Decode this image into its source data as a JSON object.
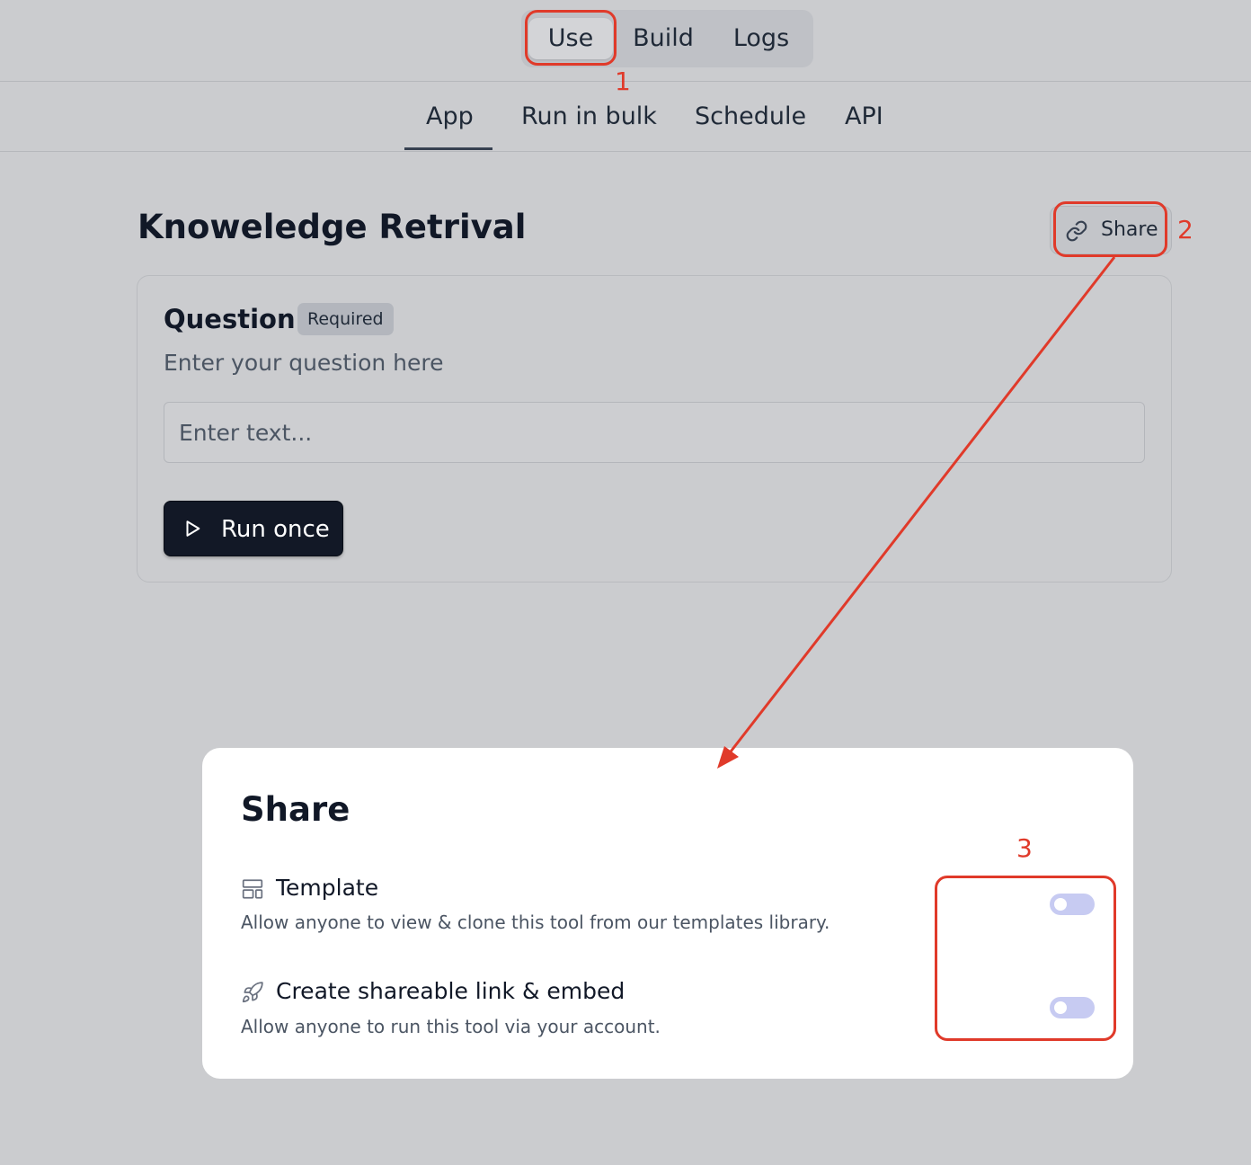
{
  "mode_switcher": {
    "items": [
      {
        "label": "Use",
        "active": true
      },
      {
        "label": "Build",
        "active": false
      },
      {
        "label": "Logs",
        "active": false
      }
    ]
  },
  "tabs": [
    {
      "label": "App",
      "active": true
    },
    {
      "label": "Run in bulk",
      "active": false
    },
    {
      "label": "Schedule",
      "active": false
    },
    {
      "label": "API",
      "active": false
    }
  ],
  "page": {
    "title": "Knoweledge Retrival",
    "share_label": "Share"
  },
  "form": {
    "question_label": "Question",
    "required_badge": "Required",
    "question_description": "Enter your question here",
    "input_value": "",
    "input_placeholder": "Enter text...",
    "run_label": "Run once"
  },
  "share_modal": {
    "title": "Share",
    "options": [
      {
        "icon": "template-icon",
        "title": "Template",
        "description": "Allow anyone to view & clone this tool from our templates library.",
        "enabled": false
      },
      {
        "icon": "rocket-icon",
        "title": "Create shareable link & embed",
        "description": "Allow anyone to run this tool via your account.",
        "enabled": false
      }
    ]
  },
  "annotations": {
    "labels": [
      "1",
      "2",
      "3"
    ],
    "color": "#e03a2a"
  },
  "colors": {
    "background": "#cbcccf",
    "primary_button": "#121826",
    "toggle_off": "#c7cbf2"
  }
}
